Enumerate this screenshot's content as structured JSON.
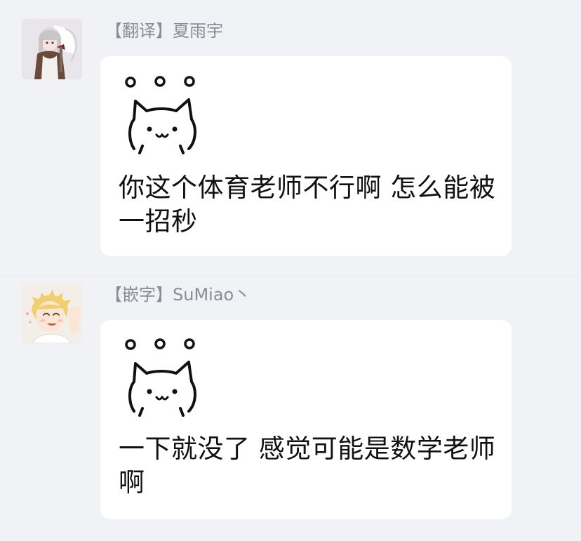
{
  "messages": [
    {
      "sender": "【翻译】夏雨宇",
      "avatar": "anime-girl-avatar",
      "sticker": "cat-sticker-icon",
      "text": "你这个体育老师不行啊 怎么能被一招秒"
    },
    {
      "sender": "【嵌字】SuMiao丶",
      "avatar": "anime-boy-avatar",
      "sticker": "cat-sticker-icon",
      "text": "一下就没了 感觉可能是数学老师啊"
    }
  ],
  "colors": {
    "background": "#f1f2f6",
    "bubble": "#ffffff",
    "sender_text": "#8b8d94",
    "message_text": "#111111"
  }
}
